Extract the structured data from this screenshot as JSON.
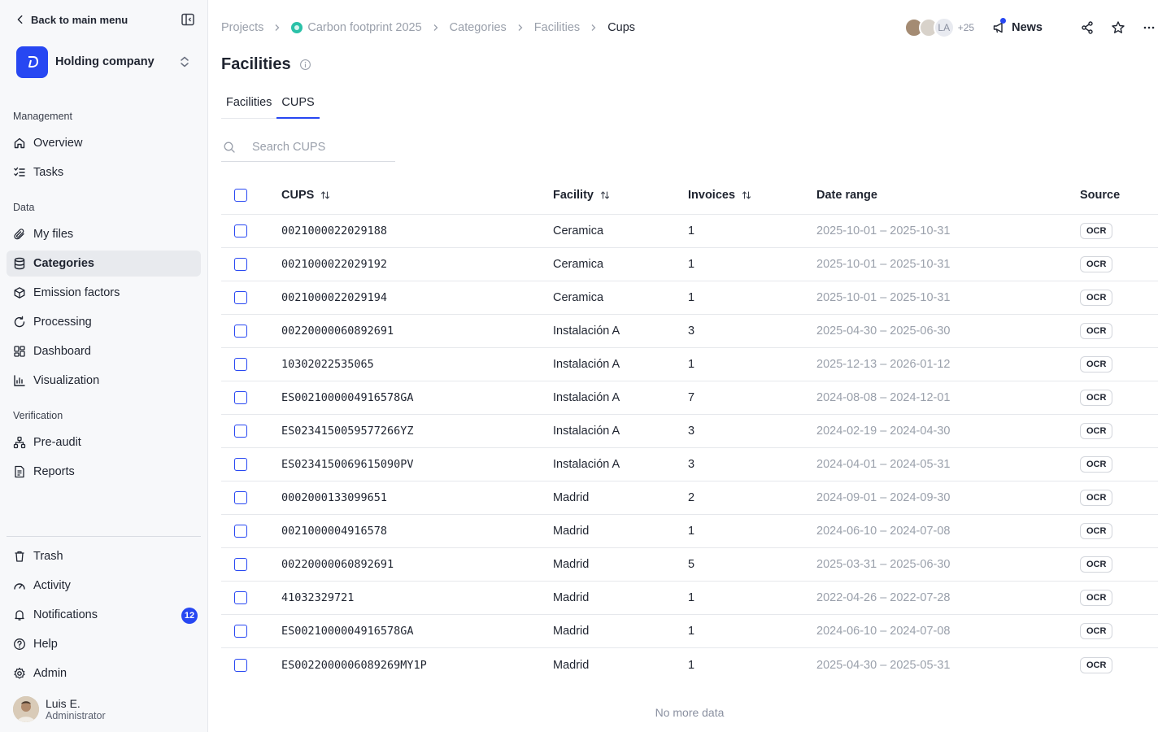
{
  "sidebar": {
    "back_label": "Back to main menu",
    "org_name": "Holding company",
    "sections": {
      "management": "Management",
      "data": "Data",
      "verification": "Verification"
    },
    "items": {
      "overview": "Overview",
      "tasks": "Tasks",
      "my_files": "My files",
      "categories": "Categories",
      "emission_factors": "Emission factors",
      "processing": "Processing",
      "dashboard": "Dashboard",
      "visualization": "Visualization",
      "pre_audit": "Pre-audit",
      "reports": "Reports",
      "trash": "Trash",
      "activity": "Activity",
      "notifications": "Notifications",
      "help": "Help",
      "admin": "Admin"
    },
    "notifications_count": "12",
    "user": {
      "name": "Luis E.",
      "role": "Administrator"
    }
  },
  "breadcrumb": [
    "Projects",
    "Carbon footprint 2025",
    "Categories",
    "Facilities",
    "Cups"
  ],
  "topbar": {
    "avatar_initials": "LA",
    "avatar_more": "+25",
    "news_label": "News"
  },
  "page": {
    "title": "Facilities",
    "tabs": [
      "Facilities",
      "CUPS"
    ],
    "active_tab": "CUPS",
    "search_placeholder": "Search CUPS",
    "no_more": "No more data"
  },
  "table": {
    "headers": {
      "cups": "CUPS",
      "facility": "Facility",
      "invoices": "Invoices",
      "date_range": "Date range",
      "source": "Source"
    },
    "rows": [
      {
        "cups": "0021000022029188",
        "facility": "Ceramica",
        "invoices": "1",
        "date_range": "2025-10-01 – 2025-10-31",
        "source": "OCR"
      },
      {
        "cups": "0021000022029192",
        "facility": "Ceramica",
        "invoices": "1",
        "date_range": "2025-10-01 – 2025-10-31",
        "source": "OCR"
      },
      {
        "cups": "0021000022029194",
        "facility": "Ceramica",
        "invoices": "1",
        "date_range": "2025-10-01 – 2025-10-31",
        "source": "OCR"
      },
      {
        "cups": "00220000060892691",
        "facility": "Instalación A",
        "invoices": "3",
        "date_range": "2025-04-30 – 2025-06-30",
        "source": "OCR"
      },
      {
        "cups": "10302022535065",
        "facility": "Instalación A",
        "invoices": "1",
        "date_range": "2025-12-13 – 2026-01-12",
        "source": "OCR"
      },
      {
        "cups": "ES0021000004916578GA",
        "facility": "Instalación A",
        "invoices": "7",
        "date_range": "2024-08-08 – 2024-12-01",
        "source": "OCR"
      },
      {
        "cups": "ES0234150059577266YZ",
        "facility": "Instalación A",
        "invoices": "3",
        "date_range": "2024-02-19 – 2024-04-30",
        "source": "OCR"
      },
      {
        "cups": "ES0234150069615090PV",
        "facility": "Instalación A",
        "invoices": "3",
        "date_range": "2024-04-01 – 2024-05-31",
        "source": "OCR"
      },
      {
        "cups": "0002000133099651",
        "facility": "Madrid",
        "invoices": "2",
        "date_range": "2024-09-01 – 2024-09-30",
        "source": "OCR"
      },
      {
        "cups": "0021000004916578",
        "facility": "Madrid",
        "invoices": "1",
        "date_range": "2024-06-10 – 2024-07-08",
        "source": "OCR"
      },
      {
        "cups": "00220000060892691",
        "facility": "Madrid",
        "invoices": "5",
        "date_range": "2025-03-31 – 2025-06-30",
        "source": "OCR"
      },
      {
        "cups": "41032329721",
        "facility": "Madrid",
        "invoices": "1",
        "date_range": "2022-04-26 – 2022-07-28",
        "source": "OCR"
      },
      {
        "cups": "ES0021000004916578GA",
        "facility": "Madrid",
        "invoices": "1",
        "date_range": "2024-06-10 – 2024-07-08",
        "source": "OCR"
      },
      {
        "cups": "ES0022000006089269MY1P",
        "facility": "Madrid",
        "invoices": "1",
        "date_range": "2025-04-30 – 2025-05-31",
        "source": "OCR"
      }
    ]
  },
  "colors": {
    "accent": "#2747f2",
    "project_dot": "#2bc1a8"
  }
}
